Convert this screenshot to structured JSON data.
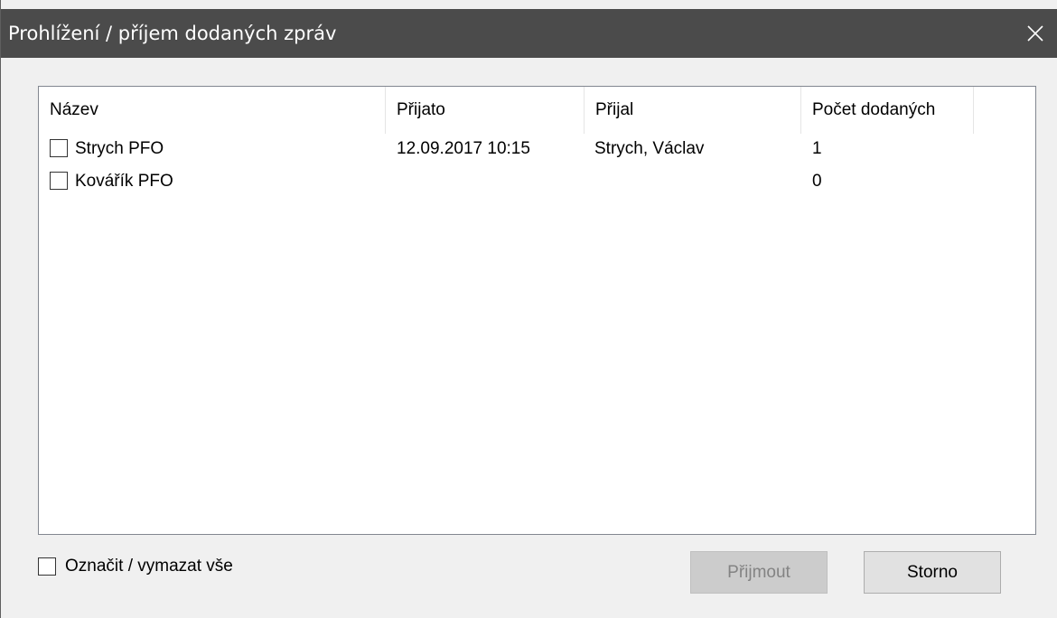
{
  "window": {
    "title": "Prohlížení / příjem dodaných zpráv",
    "close_icon": "close-icon"
  },
  "list": {
    "columns": [
      "Název",
      "Přijato",
      "Přijal",
      "Počet dodaných"
    ],
    "rows": [
      {
        "checked": false,
        "name": "Strych PFO",
        "received": "12.09.2017 10:15",
        "received_by": "Strych, Václav",
        "count": "1"
      },
      {
        "checked": false,
        "name": "Kovářík PFO",
        "received": "",
        "received_by": "",
        "count": "0"
      }
    ]
  },
  "footer": {
    "select_all_label": "Označit / vymazat vše",
    "select_all_checked": false,
    "accept_label": "Přijmout",
    "accept_enabled": false,
    "cancel_label": "Storno"
  }
}
